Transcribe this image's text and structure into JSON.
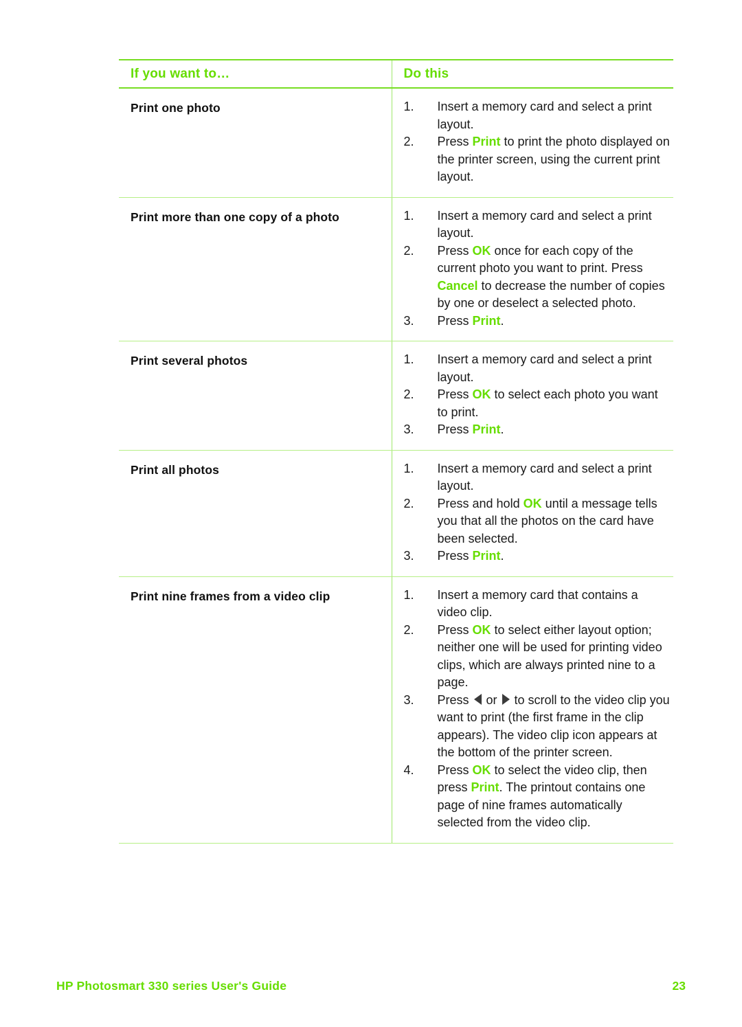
{
  "document": {
    "type": "user-guide-page",
    "accent_color": "#66dd00",
    "rule_color": "#77dd22",
    "light_rule_color": "#b6ef86"
  },
  "table": {
    "headers": {
      "left": "If you want to…",
      "right": "Do this"
    },
    "rows": [
      {
        "title": "Print one photo",
        "steps": [
          {
            "num": "1.",
            "parts": [
              {
                "t": "Insert a memory card and select a print layout."
              }
            ]
          },
          {
            "num": "2.",
            "parts": [
              {
                "t": "Press "
              },
              {
                "t": "Print",
                "kw": true
              },
              {
                "t": " to print the photo displayed on the printer screen, using the current print layout."
              }
            ]
          }
        ]
      },
      {
        "title": "Print more than one copy of a photo",
        "steps": [
          {
            "num": "1.",
            "parts": [
              {
                "t": "Insert a memory card and select a print layout."
              }
            ]
          },
          {
            "num": "2.",
            "parts": [
              {
                "t": "Press "
              },
              {
                "t": "OK",
                "kw": true
              },
              {
                "t": " once for each copy of the current photo you want to print. Press "
              },
              {
                "t": "Cancel",
                "kw": true
              },
              {
                "t": " to decrease the number of copies by one or deselect a selected photo."
              }
            ]
          },
          {
            "num": "3.",
            "parts": [
              {
                "t": "Press "
              },
              {
                "t": "Print",
                "kw": true
              },
              {
                "t": "."
              }
            ]
          }
        ]
      },
      {
        "title": "Print several photos",
        "steps": [
          {
            "num": "1.",
            "parts": [
              {
                "t": "Insert a memory card and select a print layout."
              }
            ]
          },
          {
            "num": "2.",
            "parts": [
              {
                "t": "Press "
              },
              {
                "t": "OK",
                "kw": true
              },
              {
                "t": " to select each photo you want to print."
              }
            ]
          },
          {
            "num": "3.",
            "parts": [
              {
                "t": "Press "
              },
              {
                "t": "Print",
                "kw": true
              },
              {
                "t": "."
              }
            ]
          }
        ]
      },
      {
        "title": "Print all photos",
        "steps": [
          {
            "num": "1.",
            "parts": [
              {
                "t": "Insert a memory card and select a print layout."
              }
            ]
          },
          {
            "num": "2.",
            "parts": [
              {
                "t": "Press and hold "
              },
              {
                "t": "OK",
                "kw": true
              },
              {
                "t": " until a message tells you that all the photos on the card have been selected."
              }
            ]
          },
          {
            "num": "3.",
            "parts": [
              {
                "t": "Press "
              },
              {
                "t": "Print",
                "kw": true
              },
              {
                "t": "."
              }
            ]
          }
        ]
      },
      {
        "title": "Print nine frames from a video clip",
        "steps": [
          {
            "num": "1.",
            "parts": [
              {
                "t": "Insert a memory card that contains a video clip."
              }
            ]
          },
          {
            "num": "2.",
            "parts": [
              {
                "t": "Press "
              },
              {
                "t": "OK",
                "kw": true
              },
              {
                "t": " to select either layout option; neither one will be used for printing video clips, which are always printed nine to a page."
              }
            ]
          },
          {
            "num": "3.",
            "parts": [
              {
                "t": "Press "
              },
              {
                "icon": "arrow-left-icon"
              },
              {
                "t": " or "
              },
              {
                "icon": "arrow-right-icon"
              },
              {
                "t": " to scroll to the video clip you want to print (the first frame in the clip appears). The video clip icon appears at the bottom of the printer screen."
              }
            ]
          },
          {
            "num": "4.",
            "parts": [
              {
                "t": "Press "
              },
              {
                "t": "OK",
                "kw": true
              },
              {
                "t": " to select the video clip, then press "
              },
              {
                "t": "Print",
                "kw": true
              },
              {
                "t": ". The printout contains one page of nine frames automatically selected from the video clip."
              }
            ]
          }
        ]
      }
    ]
  },
  "footer": {
    "title": "HP Photosmart 330 series User's Guide",
    "page_number": "23"
  }
}
